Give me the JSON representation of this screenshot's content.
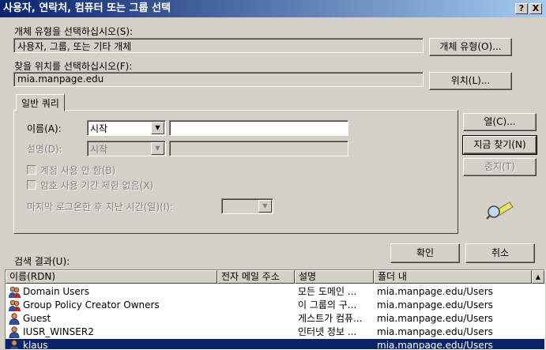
{
  "window": {
    "title": "사용자, 연락처, 컴퓨터 또는 그룹 선택",
    "help_btn": "?",
    "close_btn": "X"
  },
  "object_type": {
    "label": "개체 유형을 선택하십시오(S):",
    "value": "사용자, 그룹, 또는 기타 개체",
    "button": "개체 유형(O)..."
  },
  "location": {
    "label": "찾을 위치를 선택하십시오(F):",
    "value": "mia.manpage.edu",
    "button": "위치(L)..."
  },
  "query": {
    "tab": "일반 쿼리",
    "name_label": "이름(A):",
    "name_mode": "시작",
    "name_value": "",
    "desc_label": "설명(D):",
    "desc_mode": "시작",
    "desc_value": "",
    "disabled_accounts": "계정 사용 안 함(B)",
    "non_expiring": "암호 사용 기간 제한 없음(X)",
    "last_logon_label": "마지막 로그온한 후 지난 시간(일)(I):",
    "last_logon_value": ""
  },
  "buttons": {
    "columns": "열(C)...",
    "find_now": "지금 찾기(N)",
    "stop": "중지(T)",
    "ok": "확인",
    "cancel": "취소"
  },
  "results": {
    "label": "검색 결과(U):",
    "columns": [
      "이름(RDN)",
      "전자 메일 주소",
      "설명",
      "폴더 내"
    ],
    "rows": [
      {
        "name": "Domain Users",
        "email": "",
        "desc": "모든 도메인 ...",
        "folder": "mia.manpage.edu/Users",
        "icon": "group-icon"
      },
      {
        "name": "Group Policy Creator Owners",
        "email": "",
        "desc": "이 그룹의 구...",
        "folder": "mia.manpage.edu/Users",
        "icon": "group-icon"
      },
      {
        "name": "Guest",
        "email": "",
        "desc": "게스트가 컴퓨...",
        "folder": "mia.manpage.edu/Users",
        "icon": "user-icon"
      },
      {
        "name": "IUSR_WINSER2",
        "email": "",
        "desc": "인터넷 정보 ...",
        "folder": "mia.manpage.edu/Users",
        "icon": "user-icon"
      },
      {
        "name": "klaus",
        "email": "",
        "desc": "",
        "folder": "mia.manpage.edu/Users",
        "icon": "user-icon",
        "selected": true
      }
    ]
  }
}
